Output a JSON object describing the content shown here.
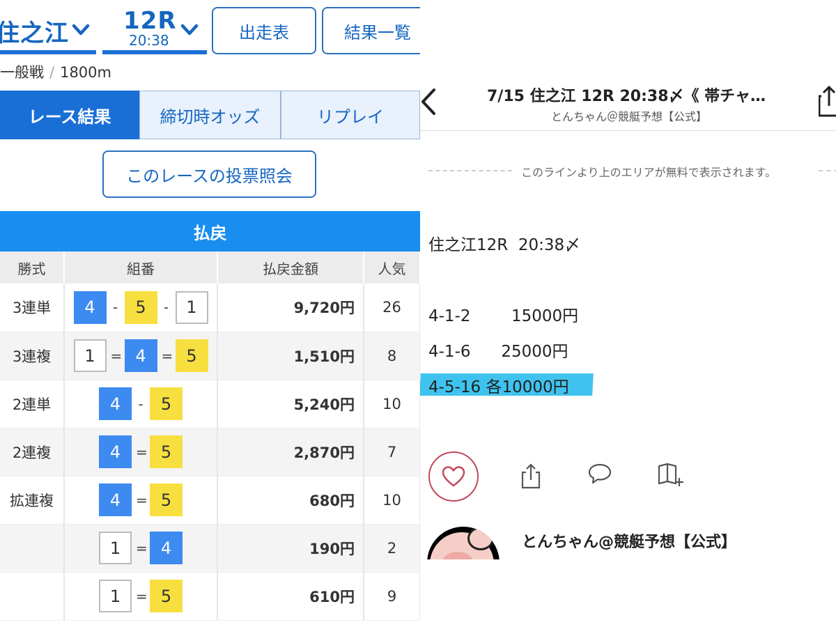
{
  "left": {
    "venue": "住之江",
    "race_no": "12R",
    "race_time": "20:38",
    "buttons": {
      "entry": "出走表",
      "results": "結果一覧"
    },
    "race_class": "一般戦",
    "distance": "1800m",
    "tabs": [
      "レース結果",
      "締切時オッズ",
      "リプレイ"
    ],
    "vote_button": "このレースの投票照会",
    "payout_header": "払戻",
    "columns": [
      "勝式",
      "組番",
      "払戻金額",
      "人気"
    ],
    "rows": [
      {
        "type": "3連単",
        "amount": "9,720円",
        "popularity": "26"
      },
      {
        "type": "3連複",
        "amount": "1,510円",
        "popularity": "8"
      },
      {
        "type": "2連単",
        "amount": "5,240円",
        "popularity": "10"
      },
      {
        "type": "2連複",
        "amount": "2,870円",
        "popularity": "7"
      },
      {
        "type": "拡連複",
        "amount": "680円",
        "popularity": "10"
      },
      {
        "type": "",
        "amount": "190円",
        "popularity": "2"
      },
      {
        "type": "",
        "amount": "610円",
        "popularity": "9"
      }
    ],
    "combos": [
      [
        "4",
        "-",
        "5",
        "-",
        "1"
      ],
      [
        "1",
        "=",
        "4",
        "=",
        "5"
      ],
      [
        "4",
        "-",
        "5"
      ],
      [
        "4",
        "=",
        "5"
      ],
      [
        "4",
        "=",
        "5"
      ],
      [
        "1",
        "=",
        "4"
      ],
      [
        "1",
        "=",
        "5"
      ]
    ],
    "colors": {
      "primary": "#1a6fd6",
      "header": "#1a8ef0",
      "boat4": "#3d8af0",
      "boat5": "#f7df3f"
    }
  },
  "right": {
    "title": "7/15 住之江 12R 20:38〆《 帯チャ…",
    "author_sub": "とんちゃん＠競艇予想【公式】",
    "free_note": "このラインより上のエリアが無料で表示されます。",
    "lines": [
      "住之江12R  20:38〆",
      "4-1-2        15000円",
      "4-1-6      25000円",
      "4-5-16 各10000円"
    ],
    "author_name": "とんちゃん@競艇予想【公式】",
    "icons": [
      "back-chevron-icon",
      "share-icon",
      "heart-icon",
      "comment-icon",
      "magazine-add-icon"
    ],
    "colors": {
      "highlight": "#3fc3ee",
      "like": "#c0485c"
    }
  }
}
